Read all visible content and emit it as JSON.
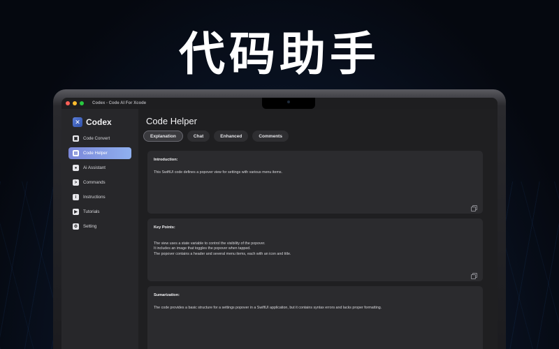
{
  "hero": {
    "title": "代码助手"
  },
  "window": {
    "title": "Codex - Code AI For Xcode",
    "traffic_lights": [
      "#ff5f57",
      "#febc2e",
      "#28c840"
    ]
  },
  "sidebar": {
    "brand": "Codex",
    "brand_icon": "wand-icon",
    "items": [
      {
        "label": "Code Convert",
        "icon": "box-icon",
        "glyph": "▣",
        "active": false
      },
      {
        "label": "Code Helper",
        "icon": "folder-icon",
        "glyph": "▤",
        "active": true
      },
      {
        "label": "Ai Assistant",
        "icon": "chat-bubble-icon",
        "glyph": "●",
        "active": false
      },
      {
        "label": "Commands",
        "icon": "terminal-icon",
        "glyph": ">",
        "active": false
      },
      {
        "label": "Instructions",
        "icon": "info-icon",
        "glyph": "i",
        "active": false
      },
      {
        "label": "Tutorials",
        "icon": "video-icon",
        "glyph": "▶",
        "active": false
      },
      {
        "label": "Setting",
        "icon": "gear-icon",
        "glyph": "⚙",
        "active": false
      }
    ]
  },
  "main": {
    "title": "Code Helper",
    "tabs": [
      {
        "label": "Explanation",
        "active": true
      },
      {
        "label": "Chat",
        "active": false
      },
      {
        "label": "Enhanced",
        "active": false
      },
      {
        "label": "Comments",
        "active": false
      }
    ],
    "cards": [
      {
        "heading": "Introduction:",
        "lines": [
          "This SwiftUI code defines a popover view for settings with various menu items."
        ]
      },
      {
        "heading": "Key Points:",
        "lines": [
          "The view uses a state variable to control the visibility of the popover.",
          "It includes an image that toggles the popover when tapped.",
          "The popover contains a header and several menu items, each with an icon and title."
        ]
      },
      {
        "heading": "Sumarization:",
        "lines": [
          "The code provides a basic structure for a settings popover in a SwiftUI application, but it contains syntax errors and lacks proper formatting."
        ]
      }
    ]
  },
  "colors": {
    "accent": "#7b87d8",
    "accent_end": "#8fb0f0"
  }
}
